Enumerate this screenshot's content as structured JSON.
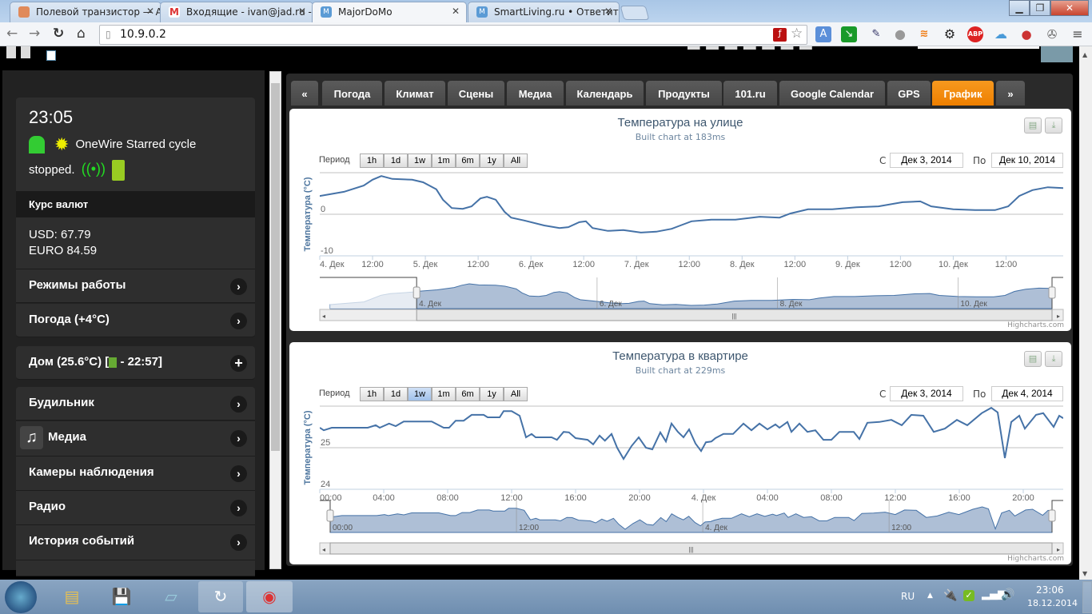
{
  "browser": {
    "tabs": [
      {
        "title": "Полевой транзистор — А",
        "icon": "person-favicon",
        "color": "#e08a5a"
      },
      {
        "title": "Входящие - ivan@jad.ru -",
        "icon": "gmail-favicon",
        "color": "#d33"
      },
      {
        "title": "MajorDoMo",
        "icon": "majordomo-favicon",
        "color": "#5b9bd5",
        "active": true
      },
      {
        "title": "SmartLiving.ru • Ответить",
        "icon": "majordomo-favicon",
        "color": "#5b9bd5"
      }
    ],
    "url": "10.9.0.2",
    "extensions": [
      "flash-icon",
      "star-icon",
      "translate-icon",
      "green-arrow-icon",
      "eyedropper-icon",
      "globe-icon",
      "rss-icon",
      "gear-icon",
      "adblock-icon",
      "cloud-icon",
      "cookie-icon",
      "film-icon",
      "menu-icon"
    ],
    "adblock_label": "ABP"
  },
  "sidebar": {
    "time": "23:05",
    "status_text_1": "OneWire Starred cycle",
    "status_text_2": "stopped.",
    "currency_header": "Курс валют",
    "usd": "USD: 67.79",
    "euro": "EURO 84.59",
    "menu_top": [
      {
        "label": "Режимы работы"
      },
      {
        "label": "Погода (+4°C)"
      }
    ],
    "home": {
      "label_pre": "Дом (25.6°C) [",
      "label_post": " - 22:57]"
    },
    "menu": [
      {
        "label": "Будильник"
      },
      {
        "label": "Медиа",
        "icon": "music-note-icon"
      },
      {
        "label": "Камеры наблюдения"
      },
      {
        "label": "Радио"
      },
      {
        "label": "История событий"
      }
    ]
  },
  "tabs": {
    "prev": "«",
    "next": "»",
    "items": [
      {
        "label": "Погода"
      },
      {
        "label": "Климат"
      },
      {
        "label": "Сцены"
      },
      {
        "label": "Медиа"
      },
      {
        "label": "Календарь"
      },
      {
        "label": "Продукты"
      },
      {
        "label": "101.ru"
      },
      {
        "label": "Google Calendar"
      },
      {
        "label": "GPS"
      },
      {
        "label": "График",
        "active": true
      }
    ],
    "active_color": "#f08300"
  },
  "range": {
    "label": "Период",
    "buttons": [
      "1h",
      "1d",
      "1w",
      "1m",
      "6m",
      "1y",
      "All"
    ],
    "from_label": "С",
    "to_label": "По"
  },
  "credits": "Highcharts.com",
  "chart_data": [
    {
      "type": "line",
      "title": "Температура на улице",
      "subtitle": "Built chart at 183ms",
      "ylabel": "Температура (°C)",
      "ylim": [
        -10,
        10
      ],
      "ytick_labels": [
        {
          "v": 0,
          "label": "0"
        },
        {
          "v": -10,
          "label": "-10"
        }
      ],
      "grid": true,
      "color": "#4572a7",
      "xlim": [
        "2014-12-04 00:00",
        "2014-12-11 01:00"
      ],
      "navigator_xlim": [
        "2014-12-03 01:00",
        "2014-12-11 01:00"
      ],
      "selected_button": null,
      "from": "Дек 3, 2014",
      "to": "Дек 10, 2014",
      "xticks": [
        {
          "at": "2014-12-04 00:00",
          "label": "4. Дек"
        },
        {
          "at": "2014-12-04 12:00",
          "label": "12:00"
        },
        {
          "at": "2014-12-05 00:00",
          "label": "5. Дек"
        },
        {
          "at": "2014-12-05 12:00",
          "label": "12:00"
        },
        {
          "at": "2014-12-06 00:00",
          "label": "6. Дек"
        },
        {
          "at": "2014-12-06 12:00",
          "label": "12:00"
        },
        {
          "at": "2014-12-07 00:00",
          "label": "7. Дек"
        },
        {
          "at": "2014-12-07 12:00",
          "label": "12:00"
        },
        {
          "at": "2014-12-08 00:00",
          "label": "8. Дек"
        },
        {
          "at": "2014-12-08 12:00",
          "label": "12:00"
        },
        {
          "at": "2014-12-09 00:00",
          "label": "9. Дек"
        },
        {
          "at": "2014-12-09 12:00",
          "label": "12:00"
        },
        {
          "at": "2014-12-10 00:00",
          "label": "10. Дек"
        },
        {
          "at": "2014-12-10 12:00",
          "label": "12:00"
        }
      ],
      "nav_ticks": [
        {
          "at": "2014-12-04 00:00",
          "label": "4. Дек"
        },
        {
          "at": "2014-12-06 00:00",
          "label": "6. Дек"
        },
        {
          "at": "2014-12-08 00:00",
          "label": "8. Дек"
        },
        {
          "at": "2014-12-10 00:00",
          "label": "10. Дек"
        }
      ],
      "series": [
        {
          "x": [
            "2014-12-03 01:00",
            "2014-12-03 10:00",
            "2014-12-03 14:30",
            "2014-12-03 17:00",
            "2014-12-03 23:00",
            "2014-12-04 00:00",
            "2014-12-04 05:30",
            "2014-12-04 10:00",
            "2014-12-04 12:00",
            "2014-12-04 14:00",
            "2014-12-04 16:30",
            "2014-12-04 21:00",
            "2014-12-04 23:30",
            "2014-12-05 02:30",
            "2014-12-05 04:00",
            "2014-12-05 06:00",
            "2014-12-05 08:30",
            "2014-12-05 10:30",
            "2014-12-05 12:30",
            "2014-12-05 14:00",
            "2014-12-05 16:00",
            "2014-12-05 18:00",
            "2014-12-05 19:30",
            "2014-12-05 22:30",
            "2014-12-06 03:00",
            "2014-12-06 06:30",
            "2014-12-06 08:30",
            "2014-12-06 11:00",
            "2014-12-06 12:30",
            "2014-12-06 14:00",
            "2014-12-06 17:30",
            "2014-12-06 21:00",
            "2014-12-07 01:00",
            "2014-12-07 04:30",
            "2014-12-07 08:00",
            "2014-12-07 10:00",
            "2014-12-07 12:30",
            "2014-12-07 17:00",
            "2014-12-07 22:30",
            "2014-12-08 04:00",
            "2014-12-08 08:30",
            "2014-12-08 11:00",
            "2014-12-08 15:00",
            "2014-12-08 20:30",
            "2014-12-09 02:00",
            "2014-12-09 07:00",
            "2014-12-09 12:30",
            "2014-12-09 16:30",
            "2014-12-09 19:00",
            "2014-12-10 00:00",
            "2014-12-10 05:00",
            "2014-12-10 09:30",
            "2014-12-10 12:30",
            "2014-12-10 15:00",
            "2014-12-10 18:00",
            "2014-12-10 21:30",
            "2014-12-11 01:00"
          ],
          "y": [
            -3.9,
            -2.2,
            2.0,
            3.0,
            4.0,
            4.4,
            5.4,
            6.9,
            8.3,
            9.2,
            8.5,
            8.3,
            7.7,
            6.0,
            3.5,
            1.5,
            1.3,
            1.9,
            3.8,
            4.2,
            3.5,
            0.6,
            -0.8,
            -1.5,
            -2.7,
            -3.3,
            -3.1,
            -1.9,
            -1.7,
            -3.3,
            -4.0,
            -3.8,
            -4.4,
            -4.2,
            -3.5,
            -2.7,
            -1.7,
            -1.3,
            -1.3,
            -0.6,
            -0.8,
            0.2,
            1.2,
            1.2,
            1.7,
            1.9,
            2.9,
            3.1,
            1.9,
            1.2,
            1.0,
            1.0,
            1.9,
            4.4,
            5.8,
            6.5,
            6.3
          ]
        }
      ]
    },
    {
      "type": "line",
      "title": "Температура в квартире",
      "subtitle": "Built chart at 229ms",
      "ylabel": "Температура (°C)",
      "ylim": [
        24,
        26
      ],
      "ytick_labels": [
        {
          "v": 25,
          "label": "25"
        },
        {
          "v": 24,
          "label": "24"
        }
      ],
      "grid": true,
      "color": "#4572a7",
      "xlim": [
        "2014-12-03 00:00",
        "2014-12-04 22:30"
      ],
      "navigator_xlim": [
        "2014-12-03 00:00",
        "2014-12-04 22:30"
      ],
      "selected_button": "1w",
      "from": "Дек 3, 2014",
      "to": "Дек 4, 2014",
      "xticks": [
        {
          "at": "2014-12-03 00:00",
          "label": "00:00"
        },
        {
          "at": "2014-12-03 04:00",
          "label": "04:00"
        },
        {
          "at": "2014-12-03 08:00",
          "label": "08:00"
        },
        {
          "at": "2014-12-03 12:00",
          "label": "12:00"
        },
        {
          "at": "2014-12-03 16:00",
          "label": "16:00"
        },
        {
          "at": "2014-12-03 20:00",
          "label": "20:00"
        },
        {
          "at": "2014-12-04 00:00",
          "label": "4. Дек"
        },
        {
          "at": "2014-12-04 04:00",
          "label": "04:00"
        },
        {
          "at": "2014-12-04 08:00",
          "label": "08:00"
        },
        {
          "at": "2014-12-04 12:00",
          "label": "12:00"
        },
        {
          "at": "2014-12-04 16:00",
          "label": "16:00"
        },
        {
          "at": "2014-12-04 20:00",
          "label": "20:00"
        }
      ],
      "nav_ticks": [
        {
          "at": "2014-12-03 00:00",
          "label": "00:00"
        },
        {
          "at": "2014-12-03 12:00",
          "label": "12:00"
        },
        {
          "at": "2014-12-04 00:00",
          "label": "4. Дек"
        },
        {
          "at": "2014-12-04 12:00",
          "label": "12:00"
        }
      ],
      "series": [
        {
          "x": [
            "2014-12-03 00:00",
            "2014-12-03 00:15",
            "2014-12-03 00:45",
            "2014-12-03 03:00",
            "2014-12-03 03:30",
            "2014-12-03 03:45",
            "2014-12-03 04:20",
            "2014-12-03 04:45",
            "2014-12-03 05:15",
            "2014-12-03 07:00",
            "2014-12-03 07:45",
            "2014-12-03 08:05",
            "2014-12-03 08:30",
            "2014-12-03 09:00",
            "2014-12-03 09:30",
            "2014-12-03 10:15",
            "2014-12-03 10:30",
            "2014-12-03 11:15",
            "2014-12-03 11:30",
            "2014-12-03 12:00",
            "2014-12-03 12:30",
            "2014-12-03 12:54",
            "2014-12-03 13:15",
            "2014-12-03 13:30",
            "2014-12-03 14:30",
            "2014-12-03 14:50",
            "2014-12-03 15:15",
            "2014-12-03 15:35",
            "2014-12-03 16:00",
            "2014-12-03 16:45",
            "2014-12-03 17:06",
            "2014-12-03 17:30",
            "2014-12-03 17:50",
            "2014-12-03 18:15",
            "2014-12-03 18:36",
            "2014-12-03 19:00",
            "2014-12-03 19:30",
            "2014-12-03 19:57",
            "2014-12-03 20:24",
            "2014-12-03 20:48",
            "2014-12-03 21:18",
            "2014-12-03 21:39",
            "2014-12-03 22:00",
            "2014-12-03 22:24",
            "2014-12-03 22:45",
            "2014-12-03 23:06",
            "2014-12-03 23:30",
            "2014-12-03 23:51",
            "2014-12-04 00:09",
            "2014-12-04 00:30",
            "2014-12-04 00:45",
            "2014-12-04 01:15",
            "2014-12-04 01:51",
            "2014-12-04 02:30",
            "2014-12-04 03:00",
            "2014-12-04 03:30",
            "2014-12-04 04:00",
            "2014-12-04 04:30",
            "2014-12-04 04:45",
            "2014-12-04 05:15",
            "2014-12-04 05:30",
            "2014-12-04 06:00",
            "2014-12-04 06:30",
            "2014-12-04 07:00",
            "2014-12-04 07:30",
            "2014-12-04 08:00",
            "2014-12-04 08:30",
            "2014-12-04 09:24",
            "2014-12-04 09:45",
            "2014-12-04 10:15",
            "2014-12-04 11:00",
            "2014-12-04 11:45",
            "2014-12-04 12:24",
            "2014-12-04 13:00",
            "2014-12-04 13:45",
            "2014-12-04 14:24",
            "2014-12-04 15:06",
            "2014-12-04 15:51",
            "2014-12-04 16:30",
            "2014-12-04 17:24",
            "2014-12-04 18:00",
            "2014-12-04 18:24",
            "2014-12-04 18:51",
            "2014-12-04 19:15",
            "2014-12-04 19:45",
            "2014-12-04 20:06",
            "2014-12-04 20:48",
            "2014-12-04 21:15",
            "2014-12-04 21:54",
            "2014-12-04 22:15",
            "2014-12-04 22:30"
          ],
          "y": [
            25.48,
            25.42,
            25.48,
            25.48,
            25.54,
            25.48,
            25.58,
            25.52,
            25.63,
            25.63,
            25.48,
            25.48,
            25.65,
            25.65,
            25.79,
            25.79,
            25.73,
            25.73,
            25.88,
            25.88,
            25.77,
            25.25,
            25.33,
            25.25,
            25.25,
            25.19,
            25.38,
            25.37,
            25.23,
            25.19,
            25.08,
            25.29,
            25.17,
            25.33,
            25.0,
            24.73,
            25.04,
            25.25,
            25.0,
            24.96,
            25.37,
            25.15,
            25.58,
            25.38,
            25.25,
            25.44,
            25.1,
            24.92,
            25.13,
            25.15,
            25.23,
            25.33,
            25.33,
            25.58,
            25.42,
            25.58,
            25.44,
            25.56,
            25.48,
            25.62,
            25.38,
            25.58,
            25.38,
            25.42,
            25.19,
            25.19,
            25.38,
            25.38,
            25.21,
            25.6,
            25.62,
            25.67,
            25.54,
            25.79,
            25.77,
            25.38,
            25.46,
            25.67,
            25.54,
            25.83,
            25.96,
            25.85,
            24.75,
            25.62,
            25.77,
            25.46,
            25.79,
            25.83,
            25.5,
            25.77,
            25.71
          ]
        }
      ]
    }
  ],
  "taskbar": {
    "apps": [
      "explorer-icon",
      "floppy-icon",
      "notepad-icon",
      "refresh-app-icon",
      "chrome-icon"
    ],
    "lang": "RU",
    "time": "23:06",
    "date": "18.12.2014"
  }
}
